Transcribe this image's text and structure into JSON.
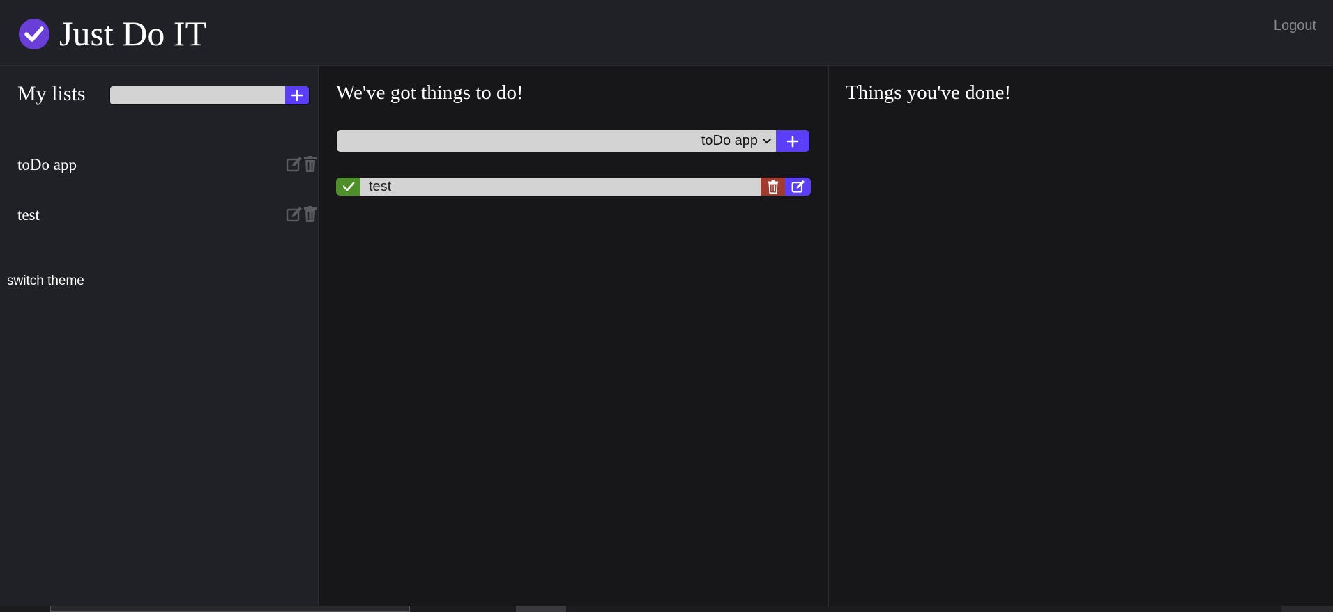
{
  "app": {
    "title": "Just Do IT",
    "logout_label": "Logout"
  },
  "sidebar": {
    "title": "My lists",
    "new_list_placeholder": "",
    "items": [
      {
        "label": "toDo app"
      },
      {
        "label": "test"
      }
    ],
    "switch_theme_label": "switch theme"
  },
  "todo": {
    "title": "We've got things to do!",
    "new_task_placeholder": "",
    "selected_list": "toDo app",
    "tasks": [
      {
        "text": "test"
      }
    ]
  },
  "done": {
    "title": "Things you've done!"
  },
  "colors": {
    "accent": "#5a3ef8",
    "complete": "#4f8f2a",
    "delete": "#a13b2e",
    "input_bg": "#d3d3d3",
    "panel_bg": "#202126",
    "main_bg": "#17171a"
  },
  "icons": {
    "logo": "check-circle-icon",
    "add": "plus-icon",
    "edit": "pen-square-icon",
    "delete": "trash-icon",
    "complete": "check-icon",
    "dropdown": "chevron-down-icon"
  }
}
